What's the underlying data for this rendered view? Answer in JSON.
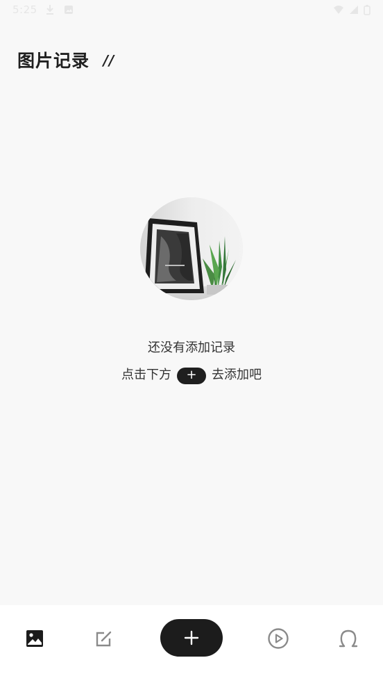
{
  "status_bar": {
    "time": "5:25"
  },
  "header": {
    "title": "图片记录",
    "title_mark": "//"
  },
  "empty_state": {
    "title": "还没有添加记录",
    "hint_before": "点击下方",
    "hint_button": "+",
    "hint_after": "去添加吧"
  },
  "bottom_nav": {
    "items": [
      {
        "name": "photos",
        "icon": "image-icon",
        "active": true
      },
      {
        "name": "notes",
        "icon": "edit-icon",
        "active": false
      },
      {
        "name": "add",
        "icon": "plus-icon",
        "active": false
      },
      {
        "name": "video",
        "icon": "play-circle-icon",
        "active": false
      },
      {
        "name": "profile",
        "icon": "profile-icon",
        "active": false
      }
    ]
  },
  "colors": {
    "background": "#f8f8f8",
    "nav_background": "#ffffff",
    "accent_dark": "#1c1c1c",
    "inactive_icon": "#8a8a8a"
  }
}
